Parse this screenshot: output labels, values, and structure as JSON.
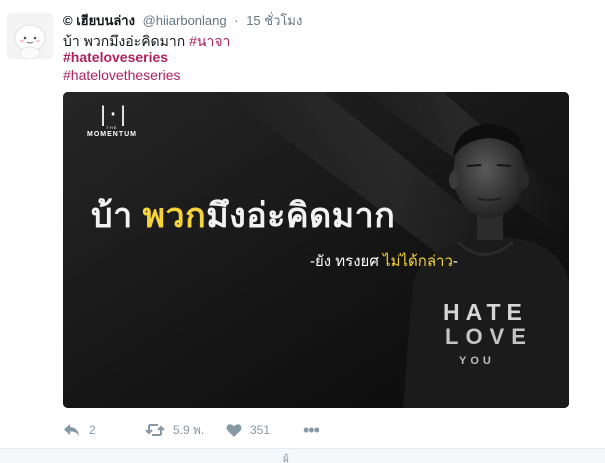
{
  "tweet": {
    "author_name": "© เฮียบนล่าง",
    "handle": "@hiiarbonlang",
    "separator": "·",
    "time": "15 ชั่วโมง",
    "text": "บ้า พวกมึงอ่ะคิดมาก",
    "tag_inline": "#นาจา",
    "tag_bold": "#hateloveseries",
    "tag_plain": "#hatelovetheseries"
  },
  "media": {
    "logo_mark": "|·|",
    "logo_the": "THE",
    "logo_word": "MOMENTUM",
    "headline_pre": "บ้า ",
    "headline_highlight": "พวก",
    "headline_post": "มึงอ่ะคิดมาก",
    "quote_pre": "-ยัง ทรงยศ ",
    "quote_highlight": "ไม่ได้กล่าว",
    "quote_post": "-",
    "shirt_word1": "HATE",
    "shirt_word2": "LOVE",
    "shirt_word3": "YOU"
  },
  "actions": {
    "reply_count": "2",
    "retweet_count": "5.9 พ.",
    "like_count": "351",
    "more_label": "•••"
  },
  "below": {
    "text": "ผู้"
  },
  "colors": {
    "hashtag": "#ac2360",
    "highlight": "#f5d33b",
    "muted": "#657786",
    "action": "#8899a6"
  }
}
